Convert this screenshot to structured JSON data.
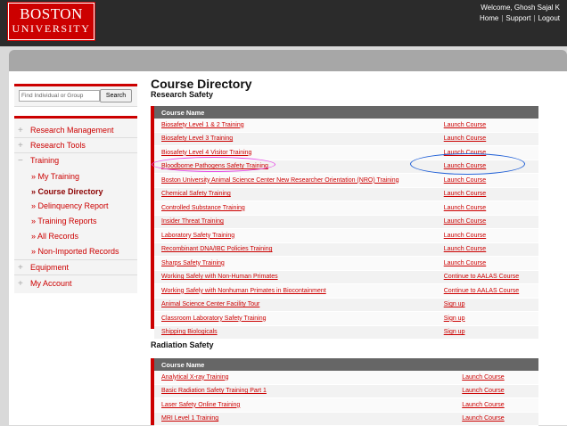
{
  "header": {
    "logo_line1": "BOSTON",
    "logo_line2": "UNIVERSITY",
    "welcome": "Welcome, Ghosh Sajal K",
    "links": [
      "Home",
      "Support",
      "Logout"
    ]
  },
  "search": {
    "placeholder": "Find Individual or Group",
    "button": "Search"
  },
  "nav": {
    "items": [
      {
        "symbol": "+",
        "label": "Research Management"
      },
      {
        "symbol": "+",
        "label": "Research Tools"
      },
      {
        "symbol": "−",
        "label": "Training"
      }
    ],
    "training_sub": [
      "» My Training",
      "» Course Directory",
      "» Delinquency Report",
      "» Training Reports",
      "» All Records",
      "» Non-Imported Records"
    ],
    "items_after": [
      {
        "symbol": "+",
        "label": "Equipment"
      },
      {
        "symbol": "+",
        "label": "My Account"
      }
    ]
  },
  "page": {
    "title": "Course Directory",
    "section1": "Research Safety",
    "section2": "Radiation Safety"
  },
  "table1": {
    "header": "Course Name",
    "rows": [
      [
        "Biosafety Level 1 & 2 Training",
        "Launch Course"
      ],
      [
        "Biosafety Level 3 Training",
        "Launch Course"
      ],
      [
        "Biosafety Level 4 Visitor Training",
        "Launch Course"
      ],
      [
        "Bloodborne Pathogens Safety Training",
        "Launch Course"
      ],
      [
        "Boston University Animal Science Center New Researcher Orientation (NRO) Training",
        "Launch Course"
      ],
      [
        "Chemical Safety Training",
        "Launch Course"
      ],
      [
        "Controlled Substance Training",
        "Launch Course"
      ],
      [
        "Insider Threat Training",
        "Launch Course"
      ],
      [
        "Laboratory Safety Training",
        "Launch Course"
      ],
      [
        "Recombinant DNA/IBC Policies Training",
        "Launch Course"
      ],
      [
        "Sharps Safety Training",
        "Launch Course"
      ],
      [
        "Working Safely with Non-Human Primates",
        "Continue to AALAS Course"
      ],
      [
        "Working Safely with Nonhuman Primates in Biocontainment",
        "Continue to AALAS Course"
      ],
      [
        "Animal Science Center Facility Tour",
        "Sign up"
      ],
      [
        "Classroom Laboratory Safety Training",
        "Sign up"
      ],
      [
        "Shipping Biologicals",
        "Sign up"
      ]
    ]
  },
  "table2": {
    "header": "Course Name",
    "rows": [
      [
        "Analytical X-ray Training",
        "Launch Course"
      ],
      [
        "Basic Radiation Safety Training Part 1",
        "Launch Course"
      ],
      [
        "Laser Safety Online Training",
        "Launch Course"
      ],
      [
        "MRI Level 1 Training",
        "Launch Course"
      ]
    ]
  },
  "colors": {
    "accent": "#cc0000",
    "header_bg": "#2b2b2b",
    "table_header": "#666666",
    "annotation_pink": "#e64ce6",
    "annotation_blue": "#1f5fd6"
  }
}
